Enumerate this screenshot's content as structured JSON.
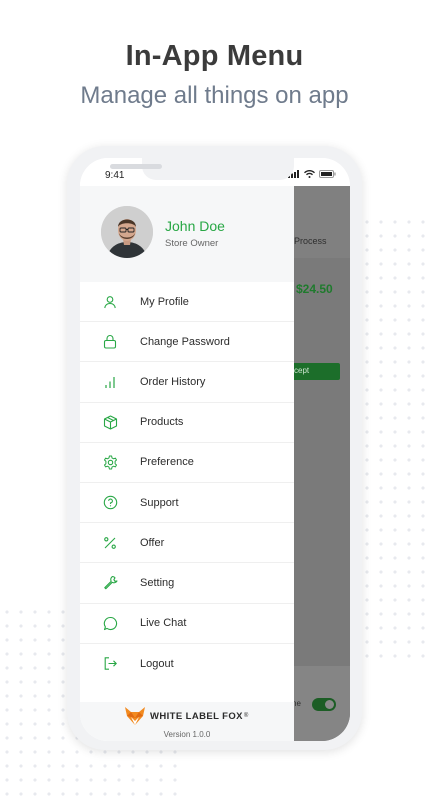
{
  "header": {
    "title": "In-App Menu",
    "subtitle": "Manage all things on app"
  },
  "statusbar": {
    "time": "9:41"
  },
  "profile": {
    "name": "John Doe",
    "role": "Store Owner"
  },
  "menu": {
    "items": [
      {
        "label": "My Profile",
        "icon": "user-icon"
      },
      {
        "label": "Change Password",
        "icon": "lock-icon"
      },
      {
        "label": "Order History",
        "icon": "bar-chart-icon"
      },
      {
        "label": "Products",
        "icon": "box-icon"
      },
      {
        "label": "Preference",
        "icon": "gear-icon"
      },
      {
        "label": "Support",
        "icon": "help-circle-icon"
      },
      {
        "label": "Offer",
        "icon": "percent-icon"
      },
      {
        "label": "Setting",
        "icon": "wrench-icon"
      },
      {
        "label": "Live Chat",
        "icon": "chat-bubble-icon"
      },
      {
        "label": "Logout",
        "icon": "logout-icon"
      }
    ]
  },
  "footer": {
    "brand": "WHITE LABEL FOX",
    "trademark": "®",
    "version": "Version 1.0.0"
  },
  "background_app": {
    "column_header": "Process",
    "price": "$24.50",
    "button_label": "cept",
    "toggle_label": "ne"
  },
  "colors": {
    "accent": "#28a745",
    "drawer_bg": "#ffffff",
    "overlay": "#7a7a7a"
  }
}
